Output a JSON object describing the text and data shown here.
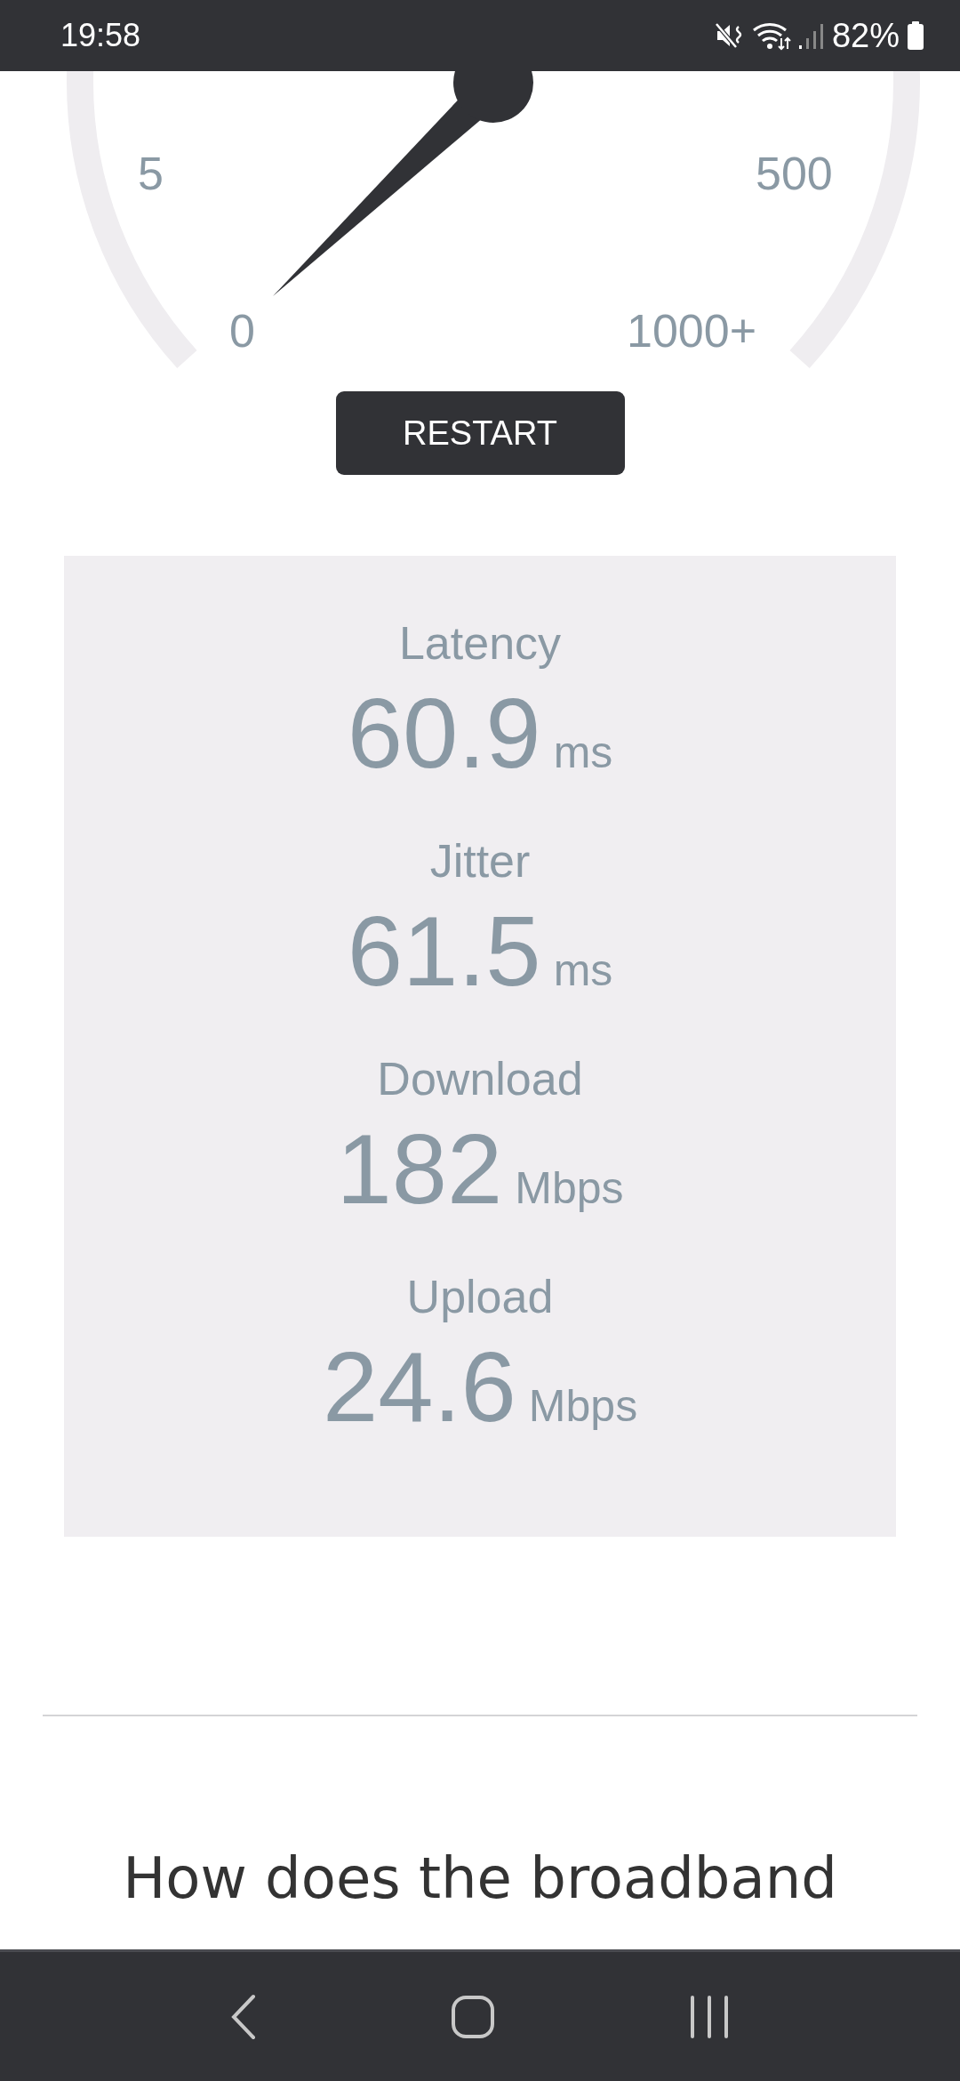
{
  "status_bar": {
    "time": "19:58",
    "battery": "82%"
  },
  "gauge": {
    "scale_labels": [
      "5",
      "500",
      "0",
      "1000+"
    ]
  },
  "restart_button": {
    "label": "RESTART"
  },
  "results": [
    {
      "label": "Latency",
      "value": "60.9",
      "unit": "ms"
    },
    {
      "label": "Jitter",
      "value": "61.5",
      "unit": "ms"
    },
    {
      "label": "Download",
      "value": "182",
      "unit": "Mbps"
    },
    {
      "label": "Upload",
      "value": "24.6",
      "unit": "Mbps"
    }
  ],
  "section_heading": "How does the broadband"
}
